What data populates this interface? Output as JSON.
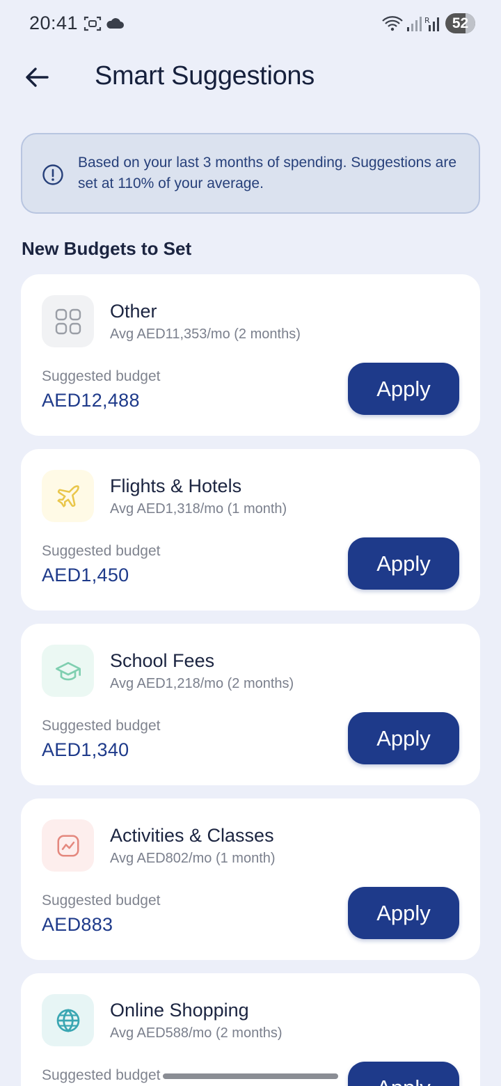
{
  "status_bar": {
    "time": "20:41",
    "battery": "52",
    "icons": [
      "screenshot-icon",
      "cloud-icon",
      "wifi-icon",
      "signal-icon",
      "signal-roaming-icon"
    ]
  },
  "header": {
    "title": "Smart Suggestions",
    "back_icon": "arrow-left-icon"
  },
  "info": {
    "text": "Based on your last 3 months of spending. Suggestions are set at 110% of your average.",
    "icon": "info-circle-icon"
  },
  "section_title": "New Budgets to Set",
  "suggestion_label": "Suggested budget",
  "apply_label": "Apply",
  "colors": {
    "accent": "#1e3a8a",
    "background": "#eceff9"
  },
  "cards": [
    {
      "name": "Other",
      "avg": "Avg AED11,353/mo (2 months)",
      "budget": "AED12,488",
      "icon": "grid-icon",
      "icon_bg": "#f1f2f4",
      "icon_color": "#9a9ea6"
    },
    {
      "name": "Flights & Hotels",
      "avg": "Avg AED1,318/mo (1 month)",
      "budget": "AED1,450",
      "icon": "plane-icon",
      "icon_bg": "#fffae6",
      "icon_color": "#e9c64a"
    },
    {
      "name": "School Fees",
      "avg": "Avg AED1,218/mo (2 months)",
      "budget": "AED1,340",
      "icon": "graduation-cap-icon",
      "icon_bg": "#ebf8f3",
      "icon_color": "#7fcfb0"
    },
    {
      "name": "Activities & Classes",
      "avg": "Avg AED802/mo (1 month)",
      "budget": "AED883",
      "icon": "activity-chart-icon",
      "icon_bg": "#fdeeed",
      "icon_color": "#e4887e"
    },
    {
      "name": "Online Shopping",
      "avg": "Avg AED588/mo (2 months)",
      "budget": "",
      "icon": "globe-icon",
      "icon_bg": "#e7f5f5",
      "icon_color": "#3aa6b2"
    }
  ]
}
